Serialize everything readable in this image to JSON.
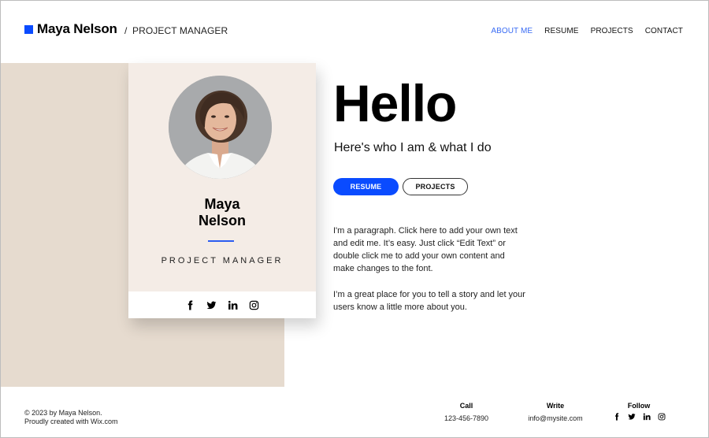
{
  "header": {
    "brand_name": "Maya Nelson",
    "separator": "/",
    "brand_role": "PROJECT MANAGER",
    "brand_color": "#0a4bff",
    "nav": [
      {
        "label": "ABOUT ME",
        "active": true
      },
      {
        "label": "RESUME",
        "active": false
      },
      {
        "label": "PROJECTS",
        "active": false
      },
      {
        "label": "CONTACT",
        "active": false
      }
    ]
  },
  "card": {
    "first_name": "Maya",
    "last_name": "Nelson",
    "role": "PROJECT MANAGER",
    "avatar_alt": "Portrait of Maya Nelson",
    "social_icons": [
      "facebook-icon",
      "twitter-icon",
      "linkedin-icon",
      "instagram-icon"
    ]
  },
  "hero": {
    "title": "Hello",
    "subtitle": "Here's who I am & what I do",
    "buttons": {
      "resume": "RESUME",
      "projects": "PROJECTS"
    },
    "paragraphs": [
      "I'm a paragraph. Click here to add your own text and edit me. It’s easy. Just click “Edit Text” or double click me to add your own content and make changes to the font.",
      "I’m a great place for you to tell a story and let your users know a little more about you."
    ]
  },
  "footer": {
    "copyright_line1": "© 2023 by Maya Nelson.",
    "copyright_line2": "Proudly created with Wix.com",
    "call": {
      "heading": "Call",
      "value": "123-456-7890"
    },
    "write": {
      "heading": "Write",
      "value": "info@mysite.com"
    },
    "follow": {
      "heading": "Follow",
      "icons": [
        "facebook-icon",
        "twitter-icon",
        "linkedin-icon",
        "instagram-icon"
      ]
    }
  },
  "colors": {
    "accent": "#0a4bff",
    "nav_active": "#3a6cf4",
    "beige_block": "#e6dbcf",
    "card_bg": "#f4ece6"
  }
}
